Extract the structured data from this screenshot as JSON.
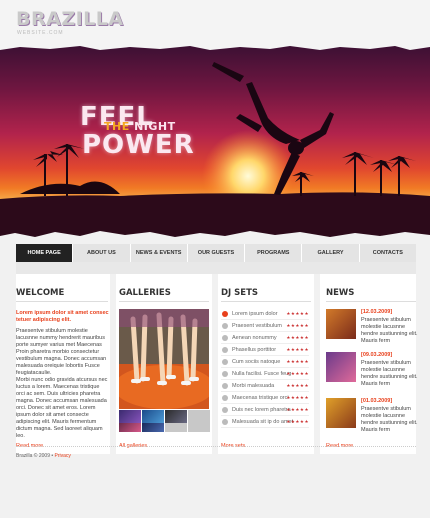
{
  "brand": {
    "name": "BRAZILLA",
    "tagline": "WEBSITE.COM"
  },
  "hero": {
    "line1": "FEEL",
    "the": "THE",
    "night": "NIGHT",
    "line3": "POWER"
  },
  "nav": [
    "HOME PAGE",
    "ABOUT US",
    "NEWS & EVENTS",
    "OUR GUESTS",
    "PROGRAMS",
    "GALLERY",
    "CONTACTS"
  ],
  "welcome": {
    "title": "WELCOME",
    "intro": "Lorem ipsum dolor sit amet consec tetuer adipiscing elit.",
    "p1": "Praesentve stibulum molestie lacusnne nummy hendrerit mauribus porte sumyer varius met Maecenas Proin pharetra morbio consectetur vestibulum magna. Donec accumsan malesuada oreiquie lobortis Fusce feugiatacaulie.",
    "p2": "Morbi nunc odio gravida atcursus nec luctus a lorem. Maecenas tristique orci ac sem. Duis ultricies pharetra magna. Donec accumsan malesuada orci. Donec sit amet eros. Lorem ipsum dolor sit amet consecte adipiscing elit. Mauris fermentum dictum magna. Sed laoreet aliquam leo.",
    "read_more": "Read more"
  },
  "galleries": {
    "title": "GALLERIES",
    "link": "All galleries"
  },
  "dj_sets": {
    "title": "DJ SETS",
    "items": [
      "Lorem ipsum dolor",
      "Praesent vestibulum",
      "Aenean nonummy",
      "Phasellus porttitor",
      "Cum sociis natoque",
      "Nulla facilisi. Fusce feug",
      "Morbi malesuada",
      "Maecenas tristique orci",
      "Duis nec lorem pharetra",
      "Malesuada sit ip do amet"
    ],
    "stars": "★★★★★",
    "link": "More sets"
  },
  "news": {
    "title": "NEWS",
    "items": [
      {
        "date": "[12.03.2009]",
        "text": "Praesentve stibulum molestie lacusnne hendre sustiunning elit. Mauris ferm"
      },
      {
        "date": "[09.03.2009]",
        "text": "Praesentve stibulum molestie lacusnne hendre sustiunning elit. Mauris ferm"
      },
      {
        "date": "[01.03.2009]",
        "text": "Praesentve stibulum molestie lacusnne hendre sustiunning elit. Mauris ferm"
      }
    ],
    "read_more": "Read more"
  },
  "footer": {
    "text": "Brazilla © 2009 •",
    "link": "Privacy"
  },
  "colors": {
    "accent": "#e8401c",
    "nav_active": "#222222"
  }
}
